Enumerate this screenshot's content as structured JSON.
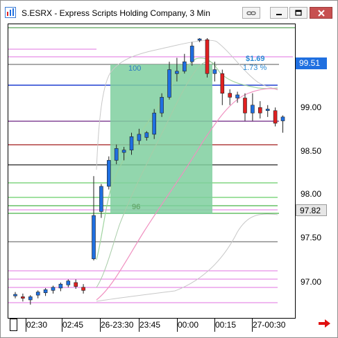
{
  "window": {
    "title": "S.ESRX - Express Scripts Holding Company, 3 Min"
  },
  "price_axis": {
    "labels": [
      "97.00",
      "97.50",
      "98.00",
      "98.50",
      "99.00"
    ],
    "current_price_box": "99.51",
    "secondary_price_box": "97.82"
  },
  "time_axis": {
    "labels": [
      "02:30",
      "02:45",
      "26-23:30",
      "23:45",
      "00:00",
      "00:15",
      "27-00:30"
    ]
  },
  "measurement": {
    "count_label": "100",
    "low_label": "96",
    "profit_label": "$1.69",
    "percent_label": "1.73 %"
  },
  "colors": {
    "up_candle": "#1f6fe0",
    "down_candle": "#e02020",
    "box_fill": "#7fcf9f",
    "accent_blue": "#2a8ad6",
    "close_button": "#c75050"
  },
  "icons": {
    "app": "chart-app-icon",
    "link": "link-icon",
    "minimize": "minimize-icon",
    "restore": "restore-icon",
    "close": "close-icon",
    "next": "right-arrow-icon"
  },
  "chart_data": {
    "type": "candlestick",
    "y_range": [
      96.75,
      100.0
    ],
    "candles": [
      {
        "o": 96.73,
        "h": 96.78,
        "l": 96.7,
        "c": 96.75
      },
      {
        "o": 96.72,
        "h": 96.76,
        "l": 96.66,
        "c": 96.7
      },
      {
        "o": 96.68,
        "h": 96.74,
        "l": 96.62,
        "c": 96.72
      },
      {
        "o": 96.74,
        "h": 96.8,
        "l": 96.7,
        "c": 96.78
      },
      {
        "o": 96.77,
        "h": 96.83,
        "l": 96.73,
        "c": 96.81
      },
      {
        "o": 96.8,
        "h": 96.86,
        "l": 96.76,
        "c": 96.84
      },
      {
        "o": 96.83,
        "h": 96.9,
        "l": 96.79,
        "c": 96.88
      },
      {
        "o": 96.87,
        "h": 96.94,
        "l": 96.84,
        "c": 96.92
      },
      {
        "o": 96.9,
        "h": 96.94,
        "l": 96.82,
        "c": 96.85
      },
      {
        "o": 96.84,
        "h": 96.88,
        "l": 96.76,
        "c": 96.8
      },
      {
        "o": 97.2,
        "h": 98.25,
        "l": 97.18,
        "c": 97.75
      },
      {
        "o": 97.8,
        "h": 98.15,
        "l": 97.72,
        "c": 98.12
      },
      {
        "o": 98.12,
        "h": 98.5,
        "l": 98.08,
        "c": 98.45
      },
      {
        "o": 98.45,
        "h": 98.65,
        "l": 98.4,
        "c": 98.6
      },
      {
        "o": 98.55,
        "h": 98.62,
        "l": 98.45,
        "c": 98.58
      },
      {
        "o": 98.58,
        "h": 98.8,
        "l": 98.52,
        "c": 98.75
      },
      {
        "o": 98.7,
        "h": 98.85,
        "l": 98.65,
        "c": 98.78
      },
      {
        "o": 98.74,
        "h": 98.82,
        "l": 98.7,
        "c": 98.8
      },
      {
        "o": 98.78,
        "h": 99.1,
        "l": 98.72,
        "c": 99.05
      },
      {
        "o": 99.05,
        "h": 99.3,
        "l": 99.0,
        "c": 99.25
      },
      {
        "o": 99.25,
        "h": 99.7,
        "l": 99.22,
        "c": 99.6
      },
      {
        "o": 99.55,
        "h": 99.75,
        "l": 99.45,
        "c": 99.58
      },
      {
        "o": 99.58,
        "h": 99.8,
        "l": 99.55,
        "c": 99.7
      },
      {
        "o": 99.7,
        "h": 99.95,
        "l": 99.65,
        "c": 99.9
      },
      {
        "o": 99.98,
        "h": 100.0,
        "l": 99.95,
        "c": 99.99
      },
      {
        "o": 99.98,
        "h": 100.0,
        "l": 99.5,
        "c": 99.55
      },
      {
        "o": 99.55,
        "h": 99.7,
        "l": 99.45,
        "c": 99.6
      },
      {
        "o": 99.55,
        "h": 99.6,
        "l": 99.15,
        "c": 99.3
      },
      {
        "o": 99.3,
        "h": 99.35,
        "l": 99.15,
        "c": 99.25
      },
      {
        "o": 99.24,
        "h": 99.32,
        "l": 99.18,
        "c": 99.28
      },
      {
        "o": 99.24,
        "h": 99.3,
        "l": 98.95,
        "c": 99.05
      },
      {
        "o": 99.05,
        "h": 99.3,
        "l": 98.95,
        "c": 99.15
      },
      {
        "o": 99.12,
        "h": 99.2,
        "l": 98.98,
        "c": 99.05
      },
      {
        "o": 99.08,
        "h": 99.15,
        "l": 99.0,
        "c": 99.1
      },
      {
        "o": 99.08,
        "h": 99.12,
        "l": 98.88,
        "c": 98.92
      },
      {
        "o": 98.95,
        "h": 99.02,
        "l": 98.8,
        "c": 99.0
      }
    ]
  }
}
